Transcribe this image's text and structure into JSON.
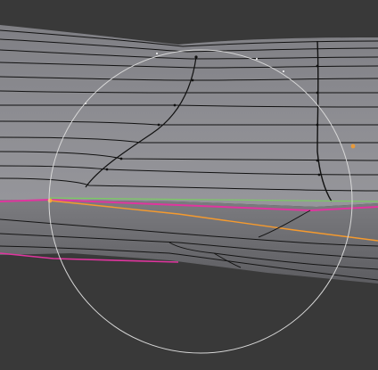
{
  "viewport": {
    "mode": "edit-mode",
    "background_color": "#393939",
    "mesh_color": "#8e8e93",
    "edge_color": "#111111",
    "seam_color": "#e0359f",
    "selected_edge_color": "#f59a2e",
    "axis_color": "#7acb63",
    "brush_circle_color": "#d8d8d8",
    "vertex_color": "#ffffff"
  }
}
